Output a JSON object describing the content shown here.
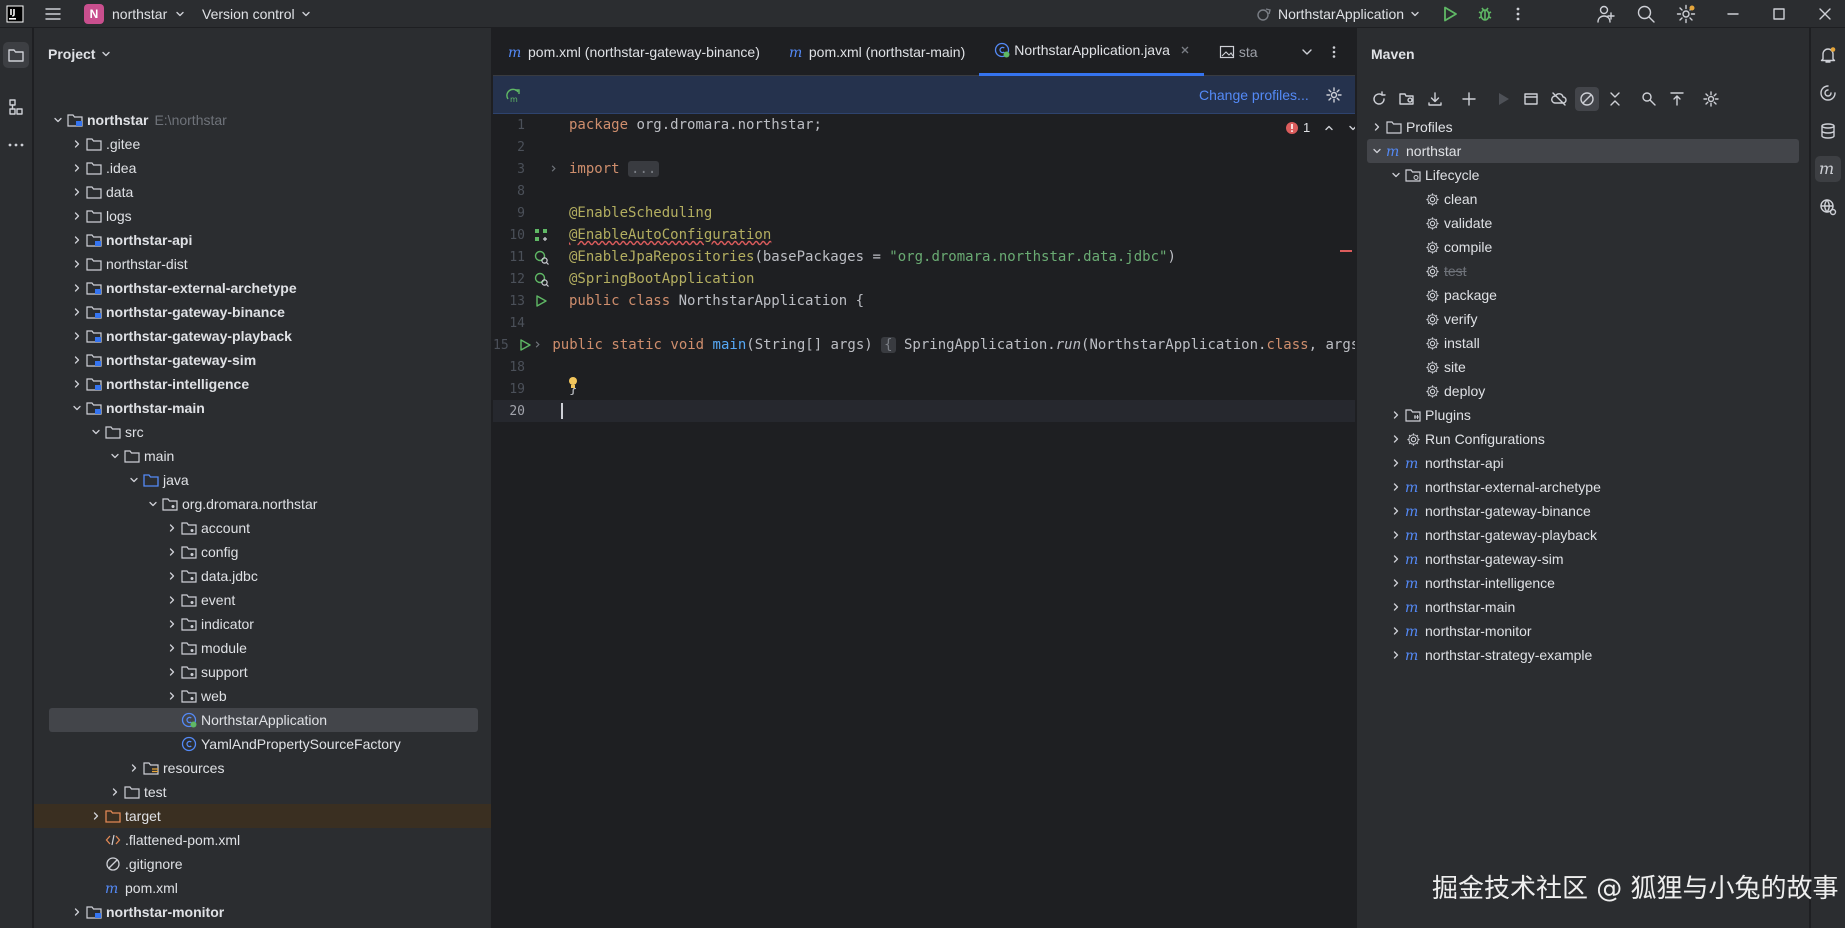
{
  "titlebar": {
    "project_badge": "N",
    "project_name": "northstar",
    "vcs_label": "Version control",
    "run_config": "NorthstarApplication"
  },
  "colors": {
    "accent": "#3574f0",
    "project_badge": "#c94f8e",
    "run_green": "#5fb865",
    "error": "#db5c5c"
  },
  "project_panel": {
    "title": "Project",
    "rows": [
      {
        "depth": 0,
        "exp": "open",
        "icon": "module-folder-icon",
        "label": "northstar",
        "hint": "E:\\northstar",
        "bold": true
      },
      {
        "depth": 1,
        "exp": "closed",
        "icon": "folder-icon",
        "label": ".gitee"
      },
      {
        "depth": 1,
        "exp": "closed",
        "icon": "folder-icon",
        "label": ".idea"
      },
      {
        "depth": 1,
        "exp": "closed",
        "icon": "folder-icon",
        "label": "data"
      },
      {
        "depth": 1,
        "exp": "closed",
        "icon": "folder-icon",
        "label": "logs"
      },
      {
        "depth": 1,
        "exp": "closed",
        "icon": "module-folder-icon",
        "label": "northstar-api",
        "bold": true
      },
      {
        "depth": 1,
        "exp": "closed",
        "icon": "folder-icon",
        "label": "northstar-dist"
      },
      {
        "depth": 1,
        "exp": "closed",
        "icon": "module-folder-icon",
        "label": "northstar-external-archetype",
        "bold": true
      },
      {
        "depth": 1,
        "exp": "closed",
        "icon": "module-folder-icon",
        "label": "northstar-gateway-binance",
        "bold": true
      },
      {
        "depth": 1,
        "exp": "closed",
        "icon": "module-folder-icon",
        "label": "northstar-gateway-playback",
        "bold": true
      },
      {
        "depth": 1,
        "exp": "closed",
        "icon": "module-folder-icon",
        "label": "northstar-gateway-sim",
        "bold": true
      },
      {
        "depth": 1,
        "exp": "closed",
        "icon": "module-folder-icon",
        "label": "northstar-intelligence",
        "bold": true
      },
      {
        "depth": 1,
        "exp": "open",
        "icon": "module-folder-icon",
        "label": "northstar-main",
        "bold": true
      },
      {
        "depth": 2,
        "exp": "open",
        "icon": "folder-icon",
        "label": "src"
      },
      {
        "depth": 3,
        "exp": "open",
        "icon": "folder-icon",
        "label": "main"
      },
      {
        "depth": 4,
        "exp": "open",
        "icon": "source-folder-icon",
        "label": "java"
      },
      {
        "depth": 5,
        "exp": "open",
        "icon": "package-icon",
        "label": "org.dromara.northstar"
      },
      {
        "depth": 6,
        "exp": "closed",
        "icon": "package-icon",
        "label": "account"
      },
      {
        "depth": 6,
        "exp": "closed",
        "icon": "package-icon",
        "label": "config"
      },
      {
        "depth": 6,
        "exp": "closed",
        "icon": "package-icon",
        "label": "data.jdbc"
      },
      {
        "depth": 6,
        "exp": "closed",
        "icon": "package-icon",
        "label": "event"
      },
      {
        "depth": 6,
        "exp": "closed",
        "icon": "package-icon",
        "label": "indicator"
      },
      {
        "depth": 6,
        "exp": "closed",
        "icon": "package-icon",
        "label": "module"
      },
      {
        "depth": 6,
        "exp": "closed",
        "icon": "package-icon",
        "label": "support"
      },
      {
        "depth": 6,
        "exp": "closed",
        "icon": "package-icon",
        "label": "web"
      },
      {
        "depth": 6,
        "exp": "none",
        "icon": "spring-class-icon",
        "label": "NorthstarApplication",
        "selected": true
      },
      {
        "depth": 6,
        "exp": "none",
        "icon": "class-icon",
        "label": "YamlAndPropertySourceFactory"
      },
      {
        "depth": 4,
        "exp": "closed",
        "icon": "resources-folder-icon",
        "label": "resources"
      },
      {
        "depth": 3,
        "exp": "closed",
        "icon": "folder-icon",
        "label": "test"
      },
      {
        "depth": 2,
        "exp": "closed",
        "icon": "excluded-folder-icon",
        "label": "target",
        "excluded": true
      },
      {
        "depth": 2,
        "exp": "none",
        "icon": "xml-file-icon",
        "label": ".flattened-pom.xml"
      },
      {
        "depth": 2,
        "exp": "none",
        "icon": "ignore-file-icon",
        "label": ".gitignore"
      },
      {
        "depth": 2,
        "exp": "none",
        "icon": "maven-file-icon",
        "label": "pom.xml"
      },
      {
        "depth": 1,
        "exp": "closed",
        "icon": "module-folder-icon",
        "label": "northstar-monitor",
        "bold": true
      },
      {
        "depth": 1,
        "exp": "closed",
        "icon": "module-folder-icon",
        "label": "northstar-strategy-example",
        "bold": true
      }
    ]
  },
  "editor": {
    "tabs": [
      {
        "icon": "maven-file-icon",
        "label": "pom.xml (northstar-gateway-binance)",
        "active": false
      },
      {
        "icon": "maven-file-icon",
        "label": "pom.xml (northstar-main)",
        "active": false
      },
      {
        "icon": "spring-class-icon",
        "label": "NorthstarApplication.java",
        "active": true
      },
      {
        "icon": "image-file-icon",
        "label": "sta",
        "active": false
      }
    ],
    "notification": {
      "action": "Change profiles..."
    },
    "error_count": "1",
    "lines": [
      {
        "n": "1",
        "tokens": [
          {
            "t": "package ",
            "c": "kw"
          },
          {
            "t": "org.dromara.northstar;"
          }
        ]
      },
      {
        "n": "2",
        "tokens": []
      },
      {
        "n": "3",
        "fold": true,
        "tokens": [
          {
            "t": "import ",
            "c": "kw"
          },
          {
            "t": "...",
            "c": "fold"
          }
        ]
      },
      {
        "n": "8",
        "tokens": []
      },
      {
        "n": "9",
        "tokens": [
          {
            "t": "@EnableScheduling",
            "c": "an"
          }
        ]
      },
      {
        "n": "10",
        "gutter": "bean-icon",
        "tokens": [
          {
            "t": "@EnableAutoConfiguration",
            "c": "an"
          }
        ]
      },
      {
        "n": "11",
        "gutter": "spring-search-icon",
        "tokens": [
          {
            "t": "@EnableJpaRepositories",
            "c": "an"
          },
          {
            "t": "(basePackages = "
          },
          {
            "t": "\"org.dromara.northstar.data.jdbc\"",
            "c": "st"
          },
          {
            "t": ")"
          }
        ]
      },
      {
        "n": "12",
        "gutter": "spring-search-icon",
        "tokens": [
          {
            "t": "@SpringBootApplication",
            "c": "an"
          }
        ]
      },
      {
        "n": "13",
        "gutter": "run-icon",
        "tokens": [
          {
            "t": "public ",
            "c": "kw"
          },
          {
            "t": "class ",
            "c": "kw"
          },
          {
            "t": "NorthstarApplication {"
          }
        ]
      },
      {
        "n": "14",
        "tokens": []
      },
      {
        "n": "15",
        "gutter": "run-icon",
        "fold": true,
        "tokens": [
          {
            "t": "    public ",
            "c": "kw"
          },
          {
            "t": "static ",
            "c": "kw"
          },
          {
            "t": "void ",
            "c": "kw"
          },
          {
            "t": "main",
            "c": "fn"
          },
          {
            "t": "(String[] args) "
          },
          {
            "t": "{",
            "c": "fold"
          },
          {
            "t": " SpringApplication."
          },
          {
            "t": "run",
            "c": "it"
          },
          {
            "t": "(NorthstarApplication."
          },
          {
            "t": "class",
            "c": "kw"
          },
          {
            "t": ", args"
          }
        ]
      },
      {
        "n": "18",
        "tokens": []
      },
      {
        "n": "19",
        "bulb": true,
        "tokens": [
          {
            "t": "}"
          }
        ]
      },
      {
        "n": "20",
        "current": true,
        "tokens": []
      }
    ]
  },
  "maven": {
    "title": "Maven",
    "rows": [
      {
        "depth": 0,
        "exp": "closed",
        "icon": "profiles-folder-icon",
        "label": "Profiles"
      },
      {
        "depth": 0,
        "exp": "open",
        "icon": "maven-icon",
        "label": "northstar",
        "selected": true
      },
      {
        "depth": 1,
        "exp": "open",
        "icon": "lifecycle-folder-icon",
        "label": "Lifecycle"
      },
      {
        "depth": 2,
        "exp": "none",
        "icon": "gear-icon",
        "label": "clean"
      },
      {
        "depth": 2,
        "exp": "none",
        "icon": "gear-icon",
        "label": "validate"
      },
      {
        "depth": 2,
        "exp": "none",
        "icon": "gear-icon",
        "label": "compile"
      },
      {
        "depth": 2,
        "exp": "none",
        "icon": "gear-icon",
        "label": "test",
        "strike": true
      },
      {
        "depth": 2,
        "exp": "none",
        "icon": "gear-icon",
        "label": "package"
      },
      {
        "depth": 2,
        "exp": "none",
        "icon": "gear-icon",
        "label": "verify"
      },
      {
        "depth": 2,
        "exp": "none",
        "icon": "gear-icon",
        "label": "install"
      },
      {
        "depth": 2,
        "exp": "none",
        "icon": "gear-icon",
        "label": "site"
      },
      {
        "depth": 2,
        "exp": "none",
        "icon": "gear-icon",
        "label": "deploy"
      },
      {
        "depth": 1,
        "exp": "closed",
        "icon": "plugins-folder-icon",
        "label": "Plugins"
      },
      {
        "depth": 1,
        "exp": "closed",
        "icon": "gear-icon",
        "label": "Run Configurations"
      },
      {
        "depth": 1,
        "exp": "closed",
        "icon": "maven-icon",
        "label": "northstar-api"
      },
      {
        "depth": 1,
        "exp": "closed",
        "icon": "maven-icon",
        "label": "northstar-external-archetype"
      },
      {
        "depth": 1,
        "exp": "closed",
        "icon": "maven-icon",
        "label": "northstar-gateway-binance"
      },
      {
        "depth": 1,
        "exp": "closed",
        "icon": "maven-icon",
        "label": "northstar-gateway-playback"
      },
      {
        "depth": 1,
        "exp": "closed",
        "icon": "maven-icon",
        "label": "northstar-gateway-sim"
      },
      {
        "depth": 1,
        "exp": "closed",
        "icon": "maven-icon",
        "label": "northstar-intelligence"
      },
      {
        "depth": 1,
        "exp": "closed",
        "icon": "maven-icon",
        "label": "northstar-main"
      },
      {
        "depth": 1,
        "exp": "closed",
        "icon": "maven-icon",
        "label": "northstar-monitor"
      },
      {
        "depth": 1,
        "exp": "closed",
        "icon": "maven-icon",
        "label": "northstar-strategy-example"
      }
    ]
  },
  "watermark": "掘金技术社区 @ 狐狸与小兔的故事"
}
